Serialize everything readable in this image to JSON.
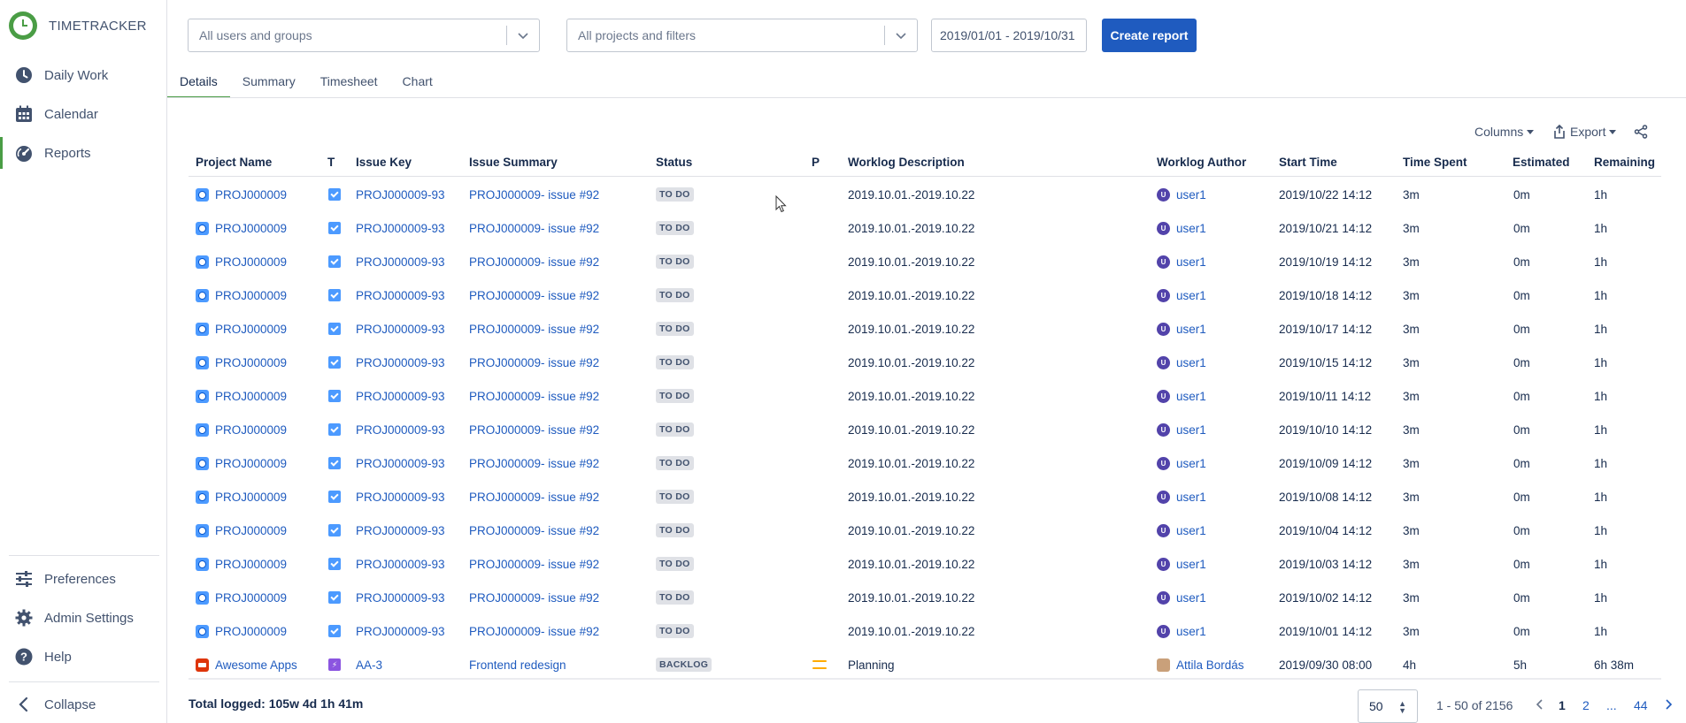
{
  "brand": {
    "name": "TIMETRACKER"
  },
  "sidebar": {
    "items": [
      {
        "label": "Daily Work",
        "icon": "clock-icon"
      },
      {
        "label": "Calendar",
        "icon": "calendar-icon"
      },
      {
        "label": "Reports",
        "icon": "gauge-icon",
        "active": true
      }
    ],
    "bottom_items": [
      {
        "label": "Preferences",
        "icon": "sliders-icon"
      },
      {
        "label": "Admin Settings",
        "icon": "gear-icon"
      },
      {
        "label": "Help",
        "icon": "help-icon"
      }
    ],
    "collapse_label": "Collapse"
  },
  "filters": {
    "users_placeholder": "All users and groups",
    "projects_placeholder": "All projects and filters",
    "date_range": "2019/01/01 - 2019/10/31",
    "create_label": "Create report"
  },
  "tabs": [
    {
      "label": "Details",
      "active": true
    },
    {
      "label": "Summary"
    },
    {
      "label": "Timesheet"
    },
    {
      "label": "Chart"
    }
  ],
  "toolbar": {
    "columns_label": "Columns",
    "export_label": "Export",
    "share_icon": "share-icon"
  },
  "table": {
    "columns": [
      "Project Name",
      "T",
      "Issue Key",
      "Issue Summary",
      "Status",
      "P",
      "Worklog Description",
      "Worklog Author",
      "Start Time",
      "Time Spent",
      "Estimated",
      "Remaining"
    ],
    "rows": [
      {
        "project": "PROJ000009",
        "type": "task",
        "key": "PROJ000009-93",
        "summary": "PROJ000009- issue #92",
        "status": "TO DO",
        "priority": "",
        "description": "2019.10.01.-2019.10.22",
        "author": "user1",
        "avatar": "U",
        "start": "2019/10/22 14:12",
        "spent": "3m",
        "estimated": "0m",
        "remaining": "1h"
      },
      {
        "project": "PROJ000009",
        "type": "task",
        "key": "PROJ000009-93",
        "summary": "PROJ000009- issue #92",
        "status": "TO DO",
        "priority": "",
        "description": "2019.10.01.-2019.10.22",
        "author": "user1",
        "avatar": "U",
        "start": "2019/10/21 14:12",
        "spent": "3m",
        "estimated": "0m",
        "remaining": "1h"
      },
      {
        "project": "PROJ000009",
        "type": "task",
        "key": "PROJ000009-93",
        "summary": "PROJ000009- issue #92",
        "status": "TO DO",
        "priority": "",
        "description": "2019.10.01.-2019.10.22",
        "author": "user1",
        "avatar": "U",
        "start": "2019/10/19 14:12",
        "spent": "3m",
        "estimated": "0m",
        "remaining": "1h"
      },
      {
        "project": "PROJ000009",
        "type": "task",
        "key": "PROJ000009-93",
        "summary": "PROJ000009- issue #92",
        "status": "TO DO",
        "priority": "",
        "description": "2019.10.01.-2019.10.22",
        "author": "user1",
        "avatar": "U",
        "start": "2019/10/18 14:12",
        "spent": "3m",
        "estimated": "0m",
        "remaining": "1h"
      },
      {
        "project": "PROJ000009",
        "type": "task",
        "key": "PROJ000009-93",
        "summary": "PROJ000009- issue #92",
        "status": "TO DO",
        "priority": "",
        "description": "2019.10.01.-2019.10.22",
        "author": "user1",
        "avatar": "U",
        "start": "2019/10/17 14:12",
        "spent": "3m",
        "estimated": "0m",
        "remaining": "1h"
      },
      {
        "project": "PROJ000009",
        "type": "task",
        "key": "PROJ000009-93",
        "summary": "PROJ000009- issue #92",
        "status": "TO DO",
        "priority": "",
        "description": "2019.10.01.-2019.10.22",
        "author": "user1",
        "avatar": "U",
        "start": "2019/10/15 14:12",
        "spent": "3m",
        "estimated": "0m",
        "remaining": "1h"
      },
      {
        "project": "PROJ000009",
        "type": "task",
        "key": "PROJ000009-93",
        "summary": "PROJ000009- issue #92",
        "status": "TO DO",
        "priority": "",
        "description": "2019.10.01.-2019.10.22",
        "author": "user1",
        "avatar": "U",
        "start": "2019/10/11 14:12",
        "spent": "3m",
        "estimated": "0m",
        "remaining": "1h"
      },
      {
        "project": "PROJ000009",
        "type": "task",
        "key": "PROJ000009-93",
        "summary": "PROJ000009- issue #92",
        "status": "TO DO",
        "priority": "",
        "description": "2019.10.01.-2019.10.22",
        "author": "user1",
        "avatar": "U",
        "start": "2019/10/10 14:12",
        "spent": "3m",
        "estimated": "0m",
        "remaining": "1h"
      },
      {
        "project": "PROJ000009",
        "type": "task",
        "key": "PROJ000009-93",
        "summary": "PROJ000009- issue #92",
        "status": "TO DO",
        "priority": "",
        "description": "2019.10.01.-2019.10.22",
        "author": "user1",
        "avatar": "U",
        "start": "2019/10/09 14:12",
        "spent": "3m",
        "estimated": "0m",
        "remaining": "1h"
      },
      {
        "project": "PROJ000009",
        "type": "task",
        "key": "PROJ000009-93",
        "summary": "PROJ000009- issue #92",
        "status": "TO DO",
        "priority": "",
        "description": "2019.10.01.-2019.10.22",
        "author": "user1",
        "avatar": "U",
        "start": "2019/10/08 14:12",
        "spent": "3m",
        "estimated": "0m",
        "remaining": "1h"
      },
      {
        "project": "PROJ000009",
        "type": "task",
        "key": "PROJ000009-93",
        "summary": "PROJ000009- issue #92",
        "status": "TO DO",
        "priority": "",
        "description": "2019.10.01.-2019.10.22",
        "author": "user1",
        "avatar": "U",
        "start": "2019/10/04 14:12",
        "spent": "3m",
        "estimated": "0m",
        "remaining": "1h"
      },
      {
        "project": "PROJ000009",
        "type": "task",
        "key": "PROJ000009-93",
        "summary": "PROJ000009- issue #92",
        "status": "TO DO",
        "priority": "",
        "description": "2019.10.01.-2019.10.22",
        "author": "user1",
        "avatar": "U",
        "start": "2019/10/03 14:12",
        "spent": "3m",
        "estimated": "0m",
        "remaining": "1h"
      },
      {
        "project": "PROJ000009",
        "type": "task",
        "key": "PROJ000009-93",
        "summary": "PROJ000009- issue #92",
        "status": "TO DO",
        "priority": "",
        "description": "2019.10.01.-2019.10.22",
        "author": "user1",
        "avatar": "U",
        "start": "2019/10/02 14:12",
        "spent": "3m",
        "estimated": "0m",
        "remaining": "1h"
      },
      {
        "project": "PROJ000009",
        "type": "task",
        "key": "PROJ000009-93",
        "summary": "PROJ000009- issue #92",
        "status": "TO DO",
        "priority": "",
        "description": "2019.10.01.-2019.10.22",
        "author": "user1",
        "avatar": "U",
        "start": "2019/10/01 14:12",
        "spent": "3m",
        "estimated": "0m",
        "remaining": "1h"
      },
      {
        "project": "Awesome Apps",
        "type": "epic",
        "key": "AA-3",
        "summary": "Frontend redesign",
        "status": "BACKLOG",
        "priority": "medium",
        "description": "Planning",
        "author": "Attila Bordás",
        "avatar": "",
        "start": "2019/09/30 08:00",
        "spent": "4h",
        "estimated": "5h",
        "remaining": "6h 38m"
      }
    ]
  },
  "footer": {
    "total": "Total logged: 105w 4d 1h 41m",
    "page_size": "50",
    "range": "1 - 50 of 2156",
    "pages": [
      "1",
      "2",
      "...",
      "44"
    ],
    "current_page": "1"
  },
  "colors": {
    "accent": "#4a9d45",
    "primary": "#1f5bbf",
    "link": "#1f5bbf",
    "text": "#172b4d"
  }
}
